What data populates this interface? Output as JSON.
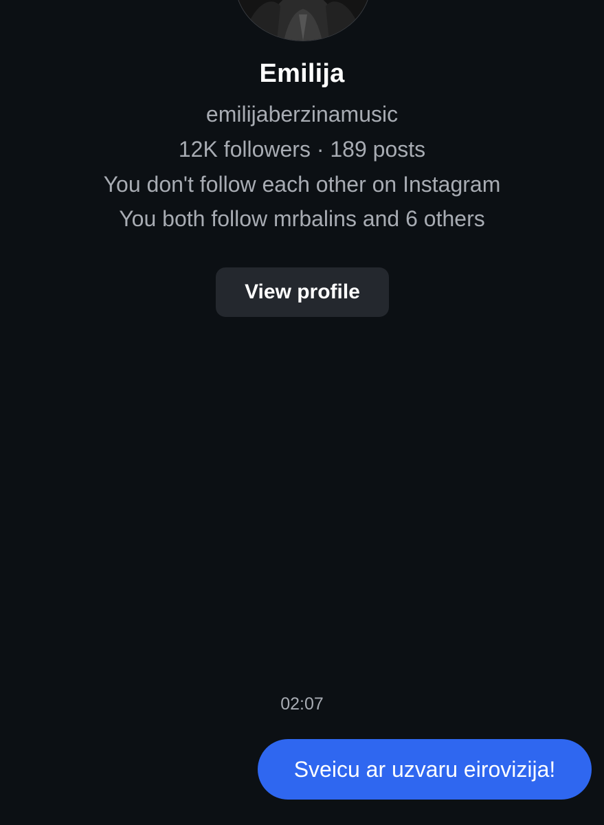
{
  "profile": {
    "avatar_icon": "profile-photo",
    "name": "Emilija",
    "handle": "emilijaberzinamusic",
    "stats": "12K followers · 189 posts",
    "follow_status": "You don't follow each other on Instagram",
    "mutuals": "You both follow mrbalins and 6 others",
    "view_profile_label": "View profile"
  },
  "conversation": {
    "timestamp": "02:07",
    "messages": [
      {
        "direction": "outgoing",
        "text": "Sveicu ar uzvaru eirovizija!"
      }
    ]
  },
  "colors": {
    "background": "#0c1014",
    "secondary_text": "#a8acb3",
    "button_bg": "#24282e",
    "outgoing_bubble": "#2f67f0"
  }
}
